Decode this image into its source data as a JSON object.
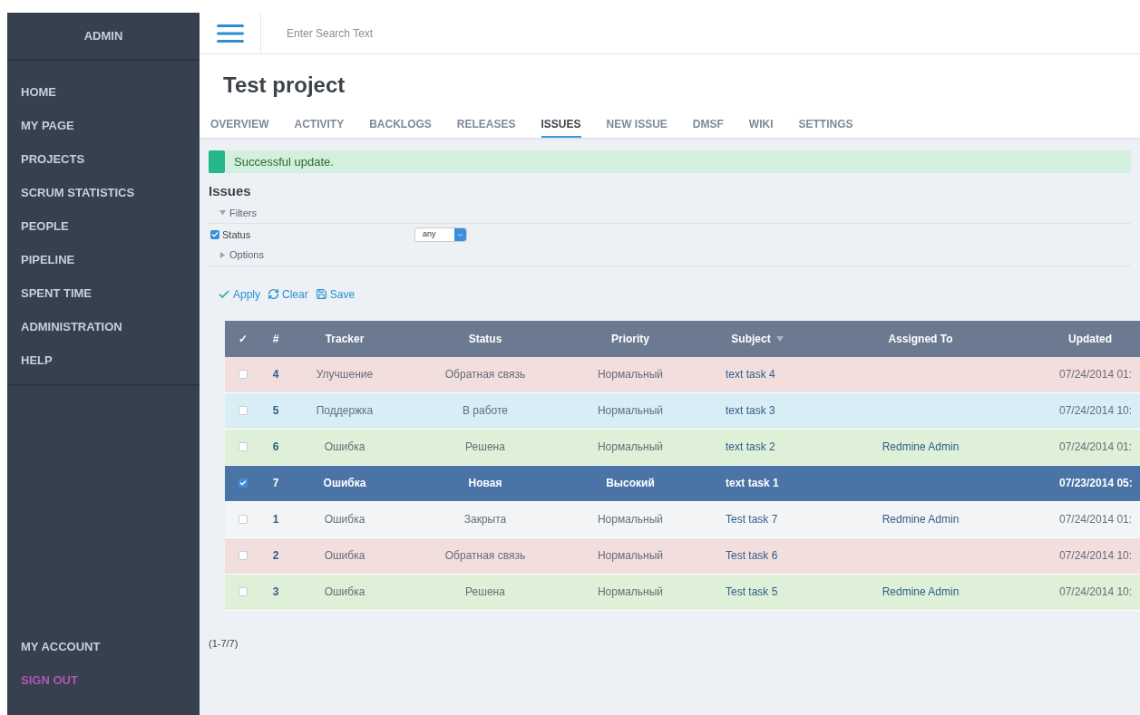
{
  "sidebar": {
    "title": "ADMIN",
    "items": [
      {
        "label": "HOME"
      },
      {
        "label": "MY PAGE"
      },
      {
        "label": "PROJECTS"
      },
      {
        "label": "SCRUM STATISTICS"
      },
      {
        "label": "PEOPLE"
      },
      {
        "label": "PIPELINE"
      },
      {
        "label": "SPENT TIME"
      },
      {
        "label": "ADMINISTRATION"
      },
      {
        "label": "HELP"
      }
    ],
    "bottom_items": [
      {
        "label": "MY ACCOUNT",
        "kind": "normal"
      },
      {
        "label": "SIGN OUT",
        "kind": "signout"
      }
    ]
  },
  "search": {
    "placeholder": "Enter Search Text"
  },
  "project": {
    "title": "Test project"
  },
  "tabs": [
    {
      "label": "OVERVIEW",
      "selected": false
    },
    {
      "label": "ACTIVITY",
      "selected": false
    },
    {
      "label": "BACKLOGS",
      "selected": false
    },
    {
      "label": "RELEASES",
      "selected": false
    },
    {
      "label": "ISSUES",
      "selected": true
    },
    {
      "label": "NEW ISSUE",
      "selected": false
    },
    {
      "label": "DMSF",
      "selected": false
    },
    {
      "label": "WIKI",
      "selected": false
    },
    {
      "label": "SETTINGS",
      "selected": false
    }
  ],
  "flash": "Successful update.",
  "issues": {
    "title": "Issues",
    "filters": {
      "label": "Filters",
      "expanded": true,
      "status_label": "Status",
      "status_checked": true,
      "status_value": "any"
    },
    "options": {
      "label": "Options",
      "expanded": false
    },
    "actions": [
      {
        "label": "Apply",
        "kind": "apply"
      },
      {
        "label": "Clear",
        "kind": "clear"
      },
      {
        "label": "Save",
        "kind": "save"
      }
    ],
    "columns": [
      "✓",
      "#",
      "Tracker",
      "Status",
      "Priority",
      "Subject",
      "Assigned To",
      "Updated"
    ],
    "rows": [
      {
        "checked": false,
        "selected": false,
        "color": "#f3dede",
        "id": "4",
        "tracker": "Улучшение",
        "status": "Обратная связь",
        "priority": "Нормальный",
        "subject": "text task 4",
        "assignee": "",
        "updated": "07/24/2014 01:"
      },
      {
        "checked": false,
        "selected": false,
        "color": "#d9edf6",
        "id": "5",
        "tracker": "Поддержка",
        "status": "В работе",
        "priority": "Нормальный",
        "subject": "text task 3",
        "assignee": "",
        "updated": "07/24/2014 10:"
      },
      {
        "checked": false,
        "selected": false,
        "color": "#dff0d8",
        "id": "6",
        "tracker": "Ошибка",
        "status": "Решена",
        "priority": "Нормальный",
        "subject": "text task 2",
        "assignee": "Redmine Admin",
        "updated": "07/24/2014 01:"
      },
      {
        "checked": true,
        "selected": true,
        "color": "#4a74a5",
        "id": "7",
        "tracker": "Ошибка",
        "status": "Новая",
        "priority": "Высокий",
        "subject": "text task 1",
        "assignee": "",
        "updated": "07/23/2014 05:"
      },
      {
        "checked": false,
        "selected": false,
        "color": "#f3f4f6",
        "id": "1",
        "tracker": "Ошибка",
        "status": "Закрыта",
        "priority": "Нормальный",
        "subject": "Test task 7",
        "assignee": "Redmine Admin",
        "updated": "07/24/2014 01:"
      },
      {
        "checked": false,
        "selected": false,
        "color": "#f3dede",
        "id": "2",
        "tracker": "Ошибка",
        "status": "Обратная связь",
        "priority": "Нормальный",
        "subject": "Test task 6",
        "assignee": "",
        "updated": "07/24/2014 10:"
      },
      {
        "checked": false,
        "selected": false,
        "color": "#dff0d8",
        "id": "3",
        "tracker": "Ошибка",
        "status": "Решена",
        "priority": "Нормальный",
        "subject": "Test task 5",
        "assignee": "Redmine Admin",
        "updated": "07/24/2014 10:"
      }
    ],
    "pagination": "(1-7/7)"
  }
}
